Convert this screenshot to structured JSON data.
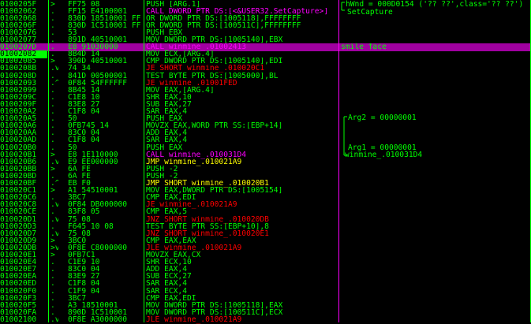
{
  "comments": {
    "hwnd_line": "hWnd = 000D0154 ('?? ??',class='?? ??')",
    "setcapture_line": "SetCapture",
    "smile_face": "smile face",
    "arg2": "Arg2 = 00000001",
    "arg1": "Arg1 = 00000001",
    "arg1_target": "winmine_.010031D4"
  },
  "colors": {
    "background": "#000000",
    "address": "#00ff00",
    "selection": "#a000a0",
    "call": "#ff00ff",
    "jump": "#ffff00",
    "conditional_jump": "#ff0000",
    "normal_text": "#00ff00",
    "separator": "#00ff00"
  },
  "rows": [
    {
      "addr": "0100205F",
      "flag": ">",
      "hex": "FF75 08",
      "dis": "PUSH [ARG.1]",
      "kind": "normal",
      "cmt": ""
    },
    {
      "addr": "01002062",
      "flag": ".",
      "hex": "FF15 E4100001",
      "dis": "CALL DWORD PTR DS:[<&USER32.SetCapture>]",
      "kind": "call",
      "cmt": ""
    },
    {
      "addr": "01002068",
      "flag": ".",
      "hex": "830D 18510001 FF",
      "dis": "OR DWORD PTR DS:[1005118],FFFFFFFF",
      "kind": "normal",
      "cmt": ""
    },
    {
      "addr": "0100206F",
      "flag": ".",
      "hex": "830D 1C510001 FF",
      "dis": "OR DWORD PTR DS:[100511C],FFFFFFFF",
      "kind": "normal",
      "cmt": ""
    },
    {
      "addr": "01002076",
      "flag": ".",
      "hex": "53",
      "dis": "PUSH EBX",
      "kind": "normal",
      "cmt": ""
    },
    {
      "addr": "01002077",
      "flag": ".",
      "hex": "891D 40510001",
      "dis": "MOV DWORD PTR DS:[1005140],EBX",
      "kind": "normal",
      "cmt": ""
    },
    {
      "addr": "0100207D",
      "flag": ".",
      "hex": "E8 91030000",
      "dis": "CALL winmine_.01002413",
      "kind": "call",
      "cmt": "smile face",
      "sel": true
    },
    {
      "addr": "01002082",
      "flag": ".",
      "hex": "8B4D 14",
      "dis": "MOV ECX,[ARG.4]",
      "kind": "normal",
      "cmt": "",
      "cur": true
    },
    {
      "addr": "01002085",
      "flag": ">",
      "hex": "390D 40510001",
      "dis": "CMP DWORD PTR DS:[1005140],EDI",
      "kind": "normal",
      "cmt": ""
    },
    {
      "addr": "0100208B",
      "flag": ".v",
      "hex": "74 34",
      "dis": "JE SHORT winmine_.010020C1",
      "kind": "cjump",
      "cmt": ""
    },
    {
      "addr": "0100208D",
      "flag": ".",
      "hex": "841D 00500001",
      "dis": "TEST BYTE PTR DS:[1005000],BL",
      "kind": "normal",
      "cmt": ""
    },
    {
      "addr": "01002093",
      "flag": ".^",
      "hex": "0F84 54FFFFFF",
      "dis": "JE winmine_.01001FED",
      "kind": "cjump",
      "cmt": ""
    },
    {
      "addr": "01002099",
      "flag": ".",
      "hex": "8B45 14",
      "dis": "MOV EAX,[ARG.4]",
      "kind": "normal",
      "cmt": ""
    },
    {
      "addr": "0100209C",
      "flag": ".",
      "hex": "C1E8 10",
      "dis": "SHR EAX,10",
      "kind": "normal",
      "cmt": ""
    },
    {
      "addr": "0100209F",
      "flag": ".",
      "hex": "83E8 27",
      "dis": "SUB EAX,27",
      "kind": "normal",
      "cmt": ""
    },
    {
      "addr": "010020A2",
      "flag": ".",
      "hex": "C1F8 04",
      "dis": "SAR EAX,4",
      "kind": "normal",
      "cmt": ""
    },
    {
      "addr": "010020A5",
      "flag": ".",
      "hex": "50",
      "dis": "PUSH EAX",
      "kind": "normal",
      "cmt": ""
    },
    {
      "addr": "010020A6",
      "flag": ".",
      "hex": "0FB745 14",
      "dis": "MOVZX EAX,WORD PTR SS:[EBP+14]",
      "kind": "normal",
      "cmt": ""
    },
    {
      "addr": "010020AA",
      "flag": ".",
      "hex": "83C0 04",
      "dis": "ADD EAX,4",
      "kind": "normal",
      "cmt": ""
    },
    {
      "addr": "010020AD",
      "flag": ".",
      "hex": "C1F8 04",
      "dis": "SAR EAX,4",
      "kind": "normal",
      "cmt": ""
    },
    {
      "addr": "010020B0",
      "flag": ".",
      "hex": "50",
      "dis": "PUSH EAX",
      "kind": "normal",
      "cmt": ""
    },
    {
      "addr": "010020B1",
      "flag": ">",
      "hex": "E8 1E110000",
      "dis": "CALL winmine_.010031D4",
      "kind": "call",
      "cmt": ""
    },
    {
      "addr": "010020B6",
      "flag": ".v",
      "hex": "E9 EE000000",
      "dis": "JMP winmine_.010021A9",
      "kind": "jump",
      "cmt": ""
    },
    {
      "addr": "010020BB",
      "flag": ">",
      "hex": "6A FE",
      "dis": "PUSH -2",
      "kind": "normal",
      "cmt": ""
    },
    {
      "addr": "010020BD",
      "flag": ".",
      "hex": "6A FE",
      "dis": "PUSH -2",
      "kind": "normal",
      "cmt": ""
    },
    {
      "addr": "010020BF",
      "flag": ".^",
      "hex": "EB F0",
      "dis": "JMP SHORT winmine_.010020B1",
      "kind": "jump",
      "cmt": ""
    },
    {
      "addr": "010020C1",
      "flag": ">",
      "hex": "A1 54510001",
      "dis": "MOV EAX,DWORD PTR DS:[1005154]",
      "kind": "normal",
      "cmt": ""
    },
    {
      "addr": "010020C6",
      "flag": ".",
      "hex": "3BC7",
      "dis": "CMP EAX,EDI",
      "kind": "normal",
      "cmt": ""
    },
    {
      "addr": "010020C8",
      "flag": ".v",
      "hex": "0F84 DB000000",
      "dis": "JE winmine_.010021A9",
      "kind": "cjump",
      "cmt": ""
    },
    {
      "addr": "010020CE",
      "flag": ".",
      "hex": "83F8 05",
      "dis": "CMP EAX,5",
      "kind": "normal",
      "cmt": ""
    },
    {
      "addr": "010020D1",
      "flag": ".v",
      "hex": "75 08",
      "dis": "JNZ SHORT winmine_.010020DB",
      "kind": "cjump",
      "cmt": ""
    },
    {
      "addr": "010020D3",
      "flag": ".",
      "hex": "F645 10 08",
      "dis": "TEST BYTE PTR SS:[EBP+10],8",
      "kind": "normal",
      "cmt": ""
    },
    {
      "addr": "010020D7",
      "flag": ".v",
      "hex": "75 08",
      "dis": "JNZ SHORT winmine_.010020E1",
      "kind": "cjump",
      "cmt": ""
    },
    {
      "addr": "010020D9",
      "flag": ">",
      "hex": "3BC0",
      "dis": "CMP EAX,EAX",
      "kind": "normal",
      "cmt": ""
    },
    {
      "addr": "010020DB",
      "flag": ">v",
      "hex": "0F8E C8000000",
      "dis": "JLE winmine_.010021A9",
      "kind": "cjump",
      "cmt": ""
    },
    {
      "addr": "010020E1",
      "flag": ">",
      "hex": "0FB7C1",
      "dis": "MOVZX EAX,CX",
      "kind": "normal",
      "cmt": ""
    },
    {
      "addr": "010020E4",
      "flag": ".",
      "hex": "C1E9 10",
      "dis": "SHR ECX,10",
      "kind": "normal",
      "cmt": ""
    },
    {
      "addr": "010020E7",
      "flag": ".",
      "hex": "83C0 04",
      "dis": "ADD EAX,4",
      "kind": "normal",
      "cmt": ""
    },
    {
      "addr": "010020EA",
      "flag": ".",
      "hex": "83E9 27",
      "dis": "SUB ECX,27",
      "kind": "normal",
      "cmt": ""
    },
    {
      "addr": "010020ED",
      "flag": ".",
      "hex": "C1F8 04",
      "dis": "SAR EAX,4",
      "kind": "normal",
      "cmt": ""
    },
    {
      "addr": "010020F0",
      "flag": ".",
      "hex": "C1F9 04",
      "dis": "SAR ECX,4",
      "kind": "normal",
      "cmt": ""
    },
    {
      "addr": "010020F3",
      "flag": ".",
      "hex": "3BC7",
      "dis": "CMP EAX,EDI",
      "kind": "normal",
      "cmt": ""
    },
    {
      "addr": "010020F5",
      "flag": ".",
      "hex": "A3 18510001",
      "dis": "MOV DWORD PTR DS:[1005118],EAX",
      "kind": "normal",
      "cmt": ""
    },
    {
      "addr": "010020FA",
      "flag": ".",
      "hex": "890D 1C510001",
      "dis": "MOV DWORD PTR DS:[100511C],ECX",
      "kind": "normal",
      "cmt": ""
    },
    {
      "addr": "01002100",
      "flag": ".v",
      "hex": "0F8E A3000000",
      "dis": "JLE winmine_.010021A9",
      "kind": "cjump",
      "cmt": ""
    }
  ]
}
